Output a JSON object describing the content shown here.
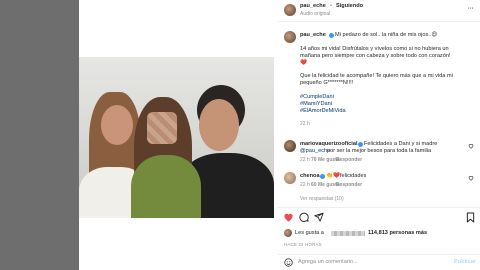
{
  "post": {
    "username": "pau_eche",
    "separator": "•",
    "follow_label": "Siguiendo",
    "audio": "Audio original",
    "more_label": "···"
  },
  "caption": {
    "username": "pau_eche",
    "line1": "Mi pedazo de sol.. la niña de mis ojos..😍",
    "line2": "14 años mi vida! Disfrútalos y vívelos como si no hubiera un",
    "line3": "mañana pero siempre con cabeza y sobre todo con corazón!",
    "line4": "❤️",
    "line5": "Que la felicidad te acompañe! Te quiero más que a mi vida mi",
    "line6": "pequeño G*******N!!!!",
    "hashtags": [
      "#CumpleDani",
      "#MamiYDani",
      "#ElAmorDeMiVida"
    ],
    "time": "22 h"
  },
  "comments": [
    {
      "username": "mariovaquerizooficial",
      "text": "Felicidades a Dani y si madre",
      "mention": "@pau_eche",
      "text2": "por ser la mejor besos para toda la familia",
      "time": "22 h",
      "likes": "76 Me gusta",
      "reply": "Responder"
    },
    {
      "username": "chenoa",
      "text": "👏❤️felicidades",
      "time": "22 h",
      "likes": "60 Me gusta",
      "reply": "Responder",
      "view_replies": "Ver respuestas (10)"
    }
  ],
  "actions": {
    "likes_prefix": "Les gusta a",
    "likes_count": "114,813 personas más",
    "time_ago": "HACE 22 HORAS"
  },
  "comment_box": {
    "placeholder": "Agrega un comentario...",
    "post_label": "Publicar"
  },
  "colors": {
    "accent": "#3897f0",
    "like_red": "#ed4956",
    "link": "#00376b"
  }
}
